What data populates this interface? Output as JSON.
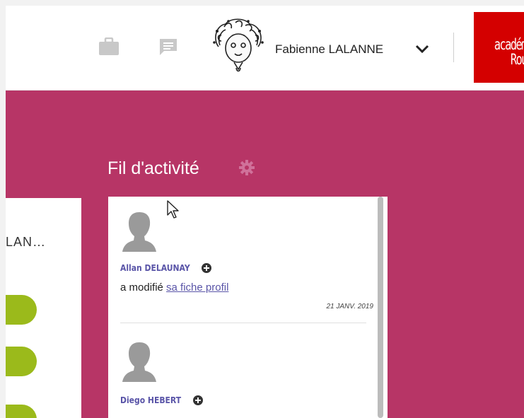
{
  "header": {
    "user_name": "Fabienne LALANNE",
    "logo_line1": "académi",
    "logo_line2": "Roue"
  },
  "left_panel": {
    "truncated_name": "LAN…"
  },
  "activity": {
    "title": "Fil d'activité",
    "entries": [
      {
        "author": "Allan DELAUNAY",
        "action": "a modifié ",
        "link_text": "sa fiche profil",
        "date": "21 JANV. 2019"
      },
      {
        "author": "Diego HEBERT",
        "action": "",
        "link_text": "",
        "date": ""
      }
    ]
  },
  "colors": {
    "main_background": "#b73566",
    "accent_green": "#9bba1b",
    "link_color": "#5a55a8",
    "logo_red": "#d40000"
  }
}
